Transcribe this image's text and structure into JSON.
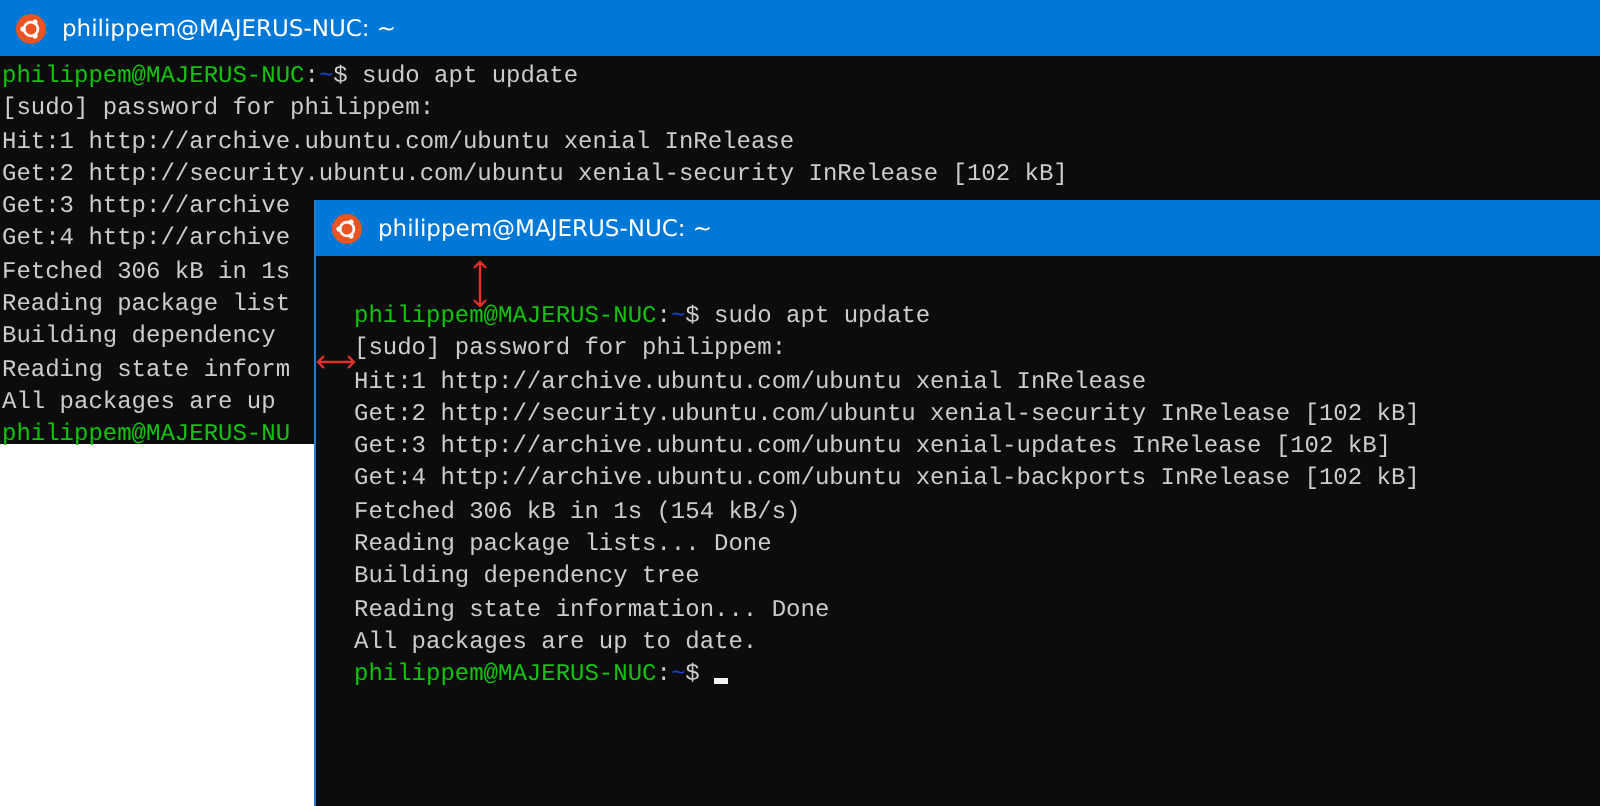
{
  "windows": [
    {
      "title": "philippem@MAJERUS-NUC: ~",
      "lines": [
        {
          "kind": "prompt",
          "user": "philippem@MAJERUS-NUC",
          "sep": ":",
          "path": "~",
          "symbol": "$",
          "command": " sudo apt update"
        },
        {
          "kind": "output",
          "text": "[sudo] password for philippem:"
        },
        {
          "kind": "output",
          "text": "Hit:1 http://archive.ubuntu.com/ubuntu xenial InRelease"
        },
        {
          "kind": "output",
          "text": "Get:2 http://security.ubuntu.com/ubuntu xenial-security InRelease [102 kB]"
        },
        {
          "kind": "output",
          "text": "Get:3 http://archive"
        },
        {
          "kind": "output",
          "text": "Get:4 http://archive"
        },
        {
          "kind": "output",
          "text": "Fetched 306 kB in 1s"
        },
        {
          "kind": "output",
          "text": "Reading package list"
        },
        {
          "kind": "output",
          "text": "Building dependency"
        },
        {
          "kind": "output",
          "text": "Reading state inform"
        },
        {
          "kind": "output",
          "text": "All packages are up"
        },
        {
          "kind": "prompt",
          "user": "philippem@MAJERUS-NU"
        }
      ]
    },
    {
      "title": "philippem@MAJERUS-NUC: ~",
      "lines": [
        {
          "kind": "prompt",
          "user": "philippem@MAJERUS-NUC",
          "sep": ":",
          "path": "~",
          "symbol": "$",
          "command": " sudo apt update"
        },
        {
          "kind": "output",
          "text": "[sudo] password for philippem:"
        },
        {
          "kind": "output",
          "text": "Hit:1 http://archive.ubuntu.com/ubuntu xenial InRelease"
        },
        {
          "kind": "output",
          "text": "Get:2 http://security.ubuntu.com/ubuntu xenial-security InRelease [102 kB]"
        },
        {
          "kind": "output",
          "text": "Get:3 http://archive.ubuntu.com/ubuntu xenial-updates InRelease [102 kB]"
        },
        {
          "kind": "output",
          "text": "Get:4 http://archive.ubuntu.com/ubuntu xenial-backports InRelease [102 kB]"
        },
        {
          "kind": "output",
          "text": "Fetched 306 kB in 1s (154 kB/s)"
        },
        {
          "kind": "output",
          "text": "Reading package lists... Done"
        },
        {
          "kind": "output",
          "text": "Building dependency tree"
        },
        {
          "kind": "output",
          "text": "Reading state information... Done"
        },
        {
          "kind": "output",
          "text": "All packages are up to date."
        },
        {
          "kind": "prompt",
          "user": "philippem@MAJERUS-NUC",
          "sep": ":",
          "path": "~",
          "symbol": "$",
          "cursor": true
        }
      ]
    }
  ]
}
